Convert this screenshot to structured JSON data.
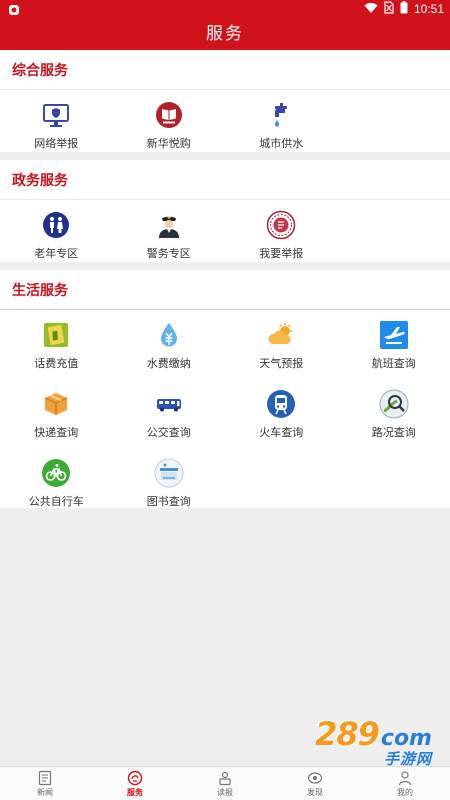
{
  "status": {
    "time": "10:51"
  },
  "header": {
    "title": "服务"
  },
  "sections": [
    {
      "title": "综合服务",
      "items": [
        {
          "label": "网络举报",
          "icon": "computer-shield-icon"
        },
        {
          "label": "新华悦购",
          "icon": "book-badge-icon"
        },
        {
          "label": "城市供水",
          "icon": "water-tap-icon"
        }
      ]
    },
    {
      "title": "政务服务",
      "items": [
        {
          "label": "老年专区",
          "icon": "elderly-couple-icon"
        },
        {
          "label": "警务专区",
          "icon": "police-officer-icon"
        },
        {
          "label": "我要举报",
          "icon": "report-seal-icon"
        }
      ]
    },
    {
      "title": "生活服务",
      "items": [
        {
          "label": "话费充值",
          "icon": "phone-card-icon"
        },
        {
          "label": "水费缴纳",
          "icon": "water-drop-icon"
        },
        {
          "label": "天气预报",
          "icon": "sun-cloud-icon"
        },
        {
          "label": "航班查询",
          "icon": "airplane-icon"
        },
        {
          "label": "快递查询",
          "icon": "parcel-box-icon"
        },
        {
          "label": "公交查询",
          "icon": "bus-icon"
        },
        {
          "label": "火车查询",
          "icon": "train-icon"
        },
        {
          "label": "路况查询",
          "icon": "road-magnifier-icon"
        },
        {
          "label": "公共自行车",
          "icon": "bicycle-icon"
        },
        {
          "label": "图书查询",
          "icon": "library-book-icon"
        }
      ]
    }
  ],
  "watermark": {
    "number": "289",
    "suffix": "com",
    "sub": "手游网"
  },
  "tabs": [
    {
      "label": "新闻",
      "icon": "news-icon",
      "active": false
    },
    {
      "label": "服务",
      "icon": "service-icon",
      "active": true
    },
    {
      "label": "读报",
      "icon": "newspaper-reader-icon",
      "active": false
    },
    {
      "label": "发现",
      "icon": "discover-icon",
      "active": false
    },
    {
      "label": "我的",
      "icon": "profile-icon",
      "active": false
    }
  ],
  "colors": {
    "brand": "#d0121b",
    "section_title": "#c0161e",
    "background": "#eeeeee"
  }
}
